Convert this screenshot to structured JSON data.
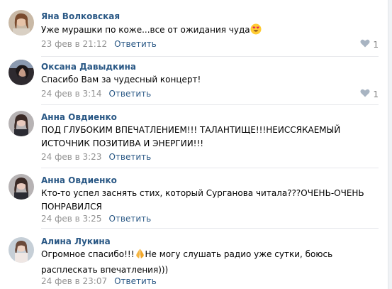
{
  "comments": [
    {
      "author": "Яна Волковская",
      "text_lines": [
        "Уже мурашки по коже...все от ожидания чуда"
      ],
      "emoji": "heart-eyes",
      "date": "23 фев в 21:12",
      "reply": "Ответить",
      "likes": "1"
    },
    {
      "author": "Оксана Давыдкина",
      "text_lines": [
        "Спасибо Вам за чудесный концерт!"
      ],
      "date": "24 фев в 3:14",
      "reply": "Ответить",
      "likes": "1"
    },
    {
      "author": "Анна Овдиенко",
      "text_lines": [
        "ПОД ГЛУБОКИМ ВПЕЧАТЛЕНИЕМ!!! ТАЛАНТИЩЕ!!!НЕИССЯКАЕМЫЙ",
        "ИСТОЧНИК ПОЗИТИВА И ЭНЕРГИИ!!!"
      ],
      "date": "24 фев в 3:23",
      "reply": "Ответить"
    },
    {
      "author": "Анна Овдиенко",
      "text_lines": [
        "Кто-то успел заснять стих, который Сурганова читала???ОЧЕНЬ-ОЧЕНЬ",
        "ПОНРАВИЛСЯ"
      ],
      "date": "24 фев в 3:25",
      "reply": "Ответить"
    },
    {
      "author": "Алина Лукина",
      "text_lines_a": "Огромное спасибо!!!",
      "text_lines_b": "Не могу слушать радио уже сутки, боюсь",
      "text_line_2": "расплескать впечатления)))",
      "emoji": "folded-hands",
      "date": "24 фев в 23:07",
      "reply": "Ответить"
    }
  ],
  "colors": {
    "link": "#2a5885",
    "meta": "#939393",
    "separator": "#e7e8ec"
  },
  "icons": {
    "like": "heart-icon"
  }
}
